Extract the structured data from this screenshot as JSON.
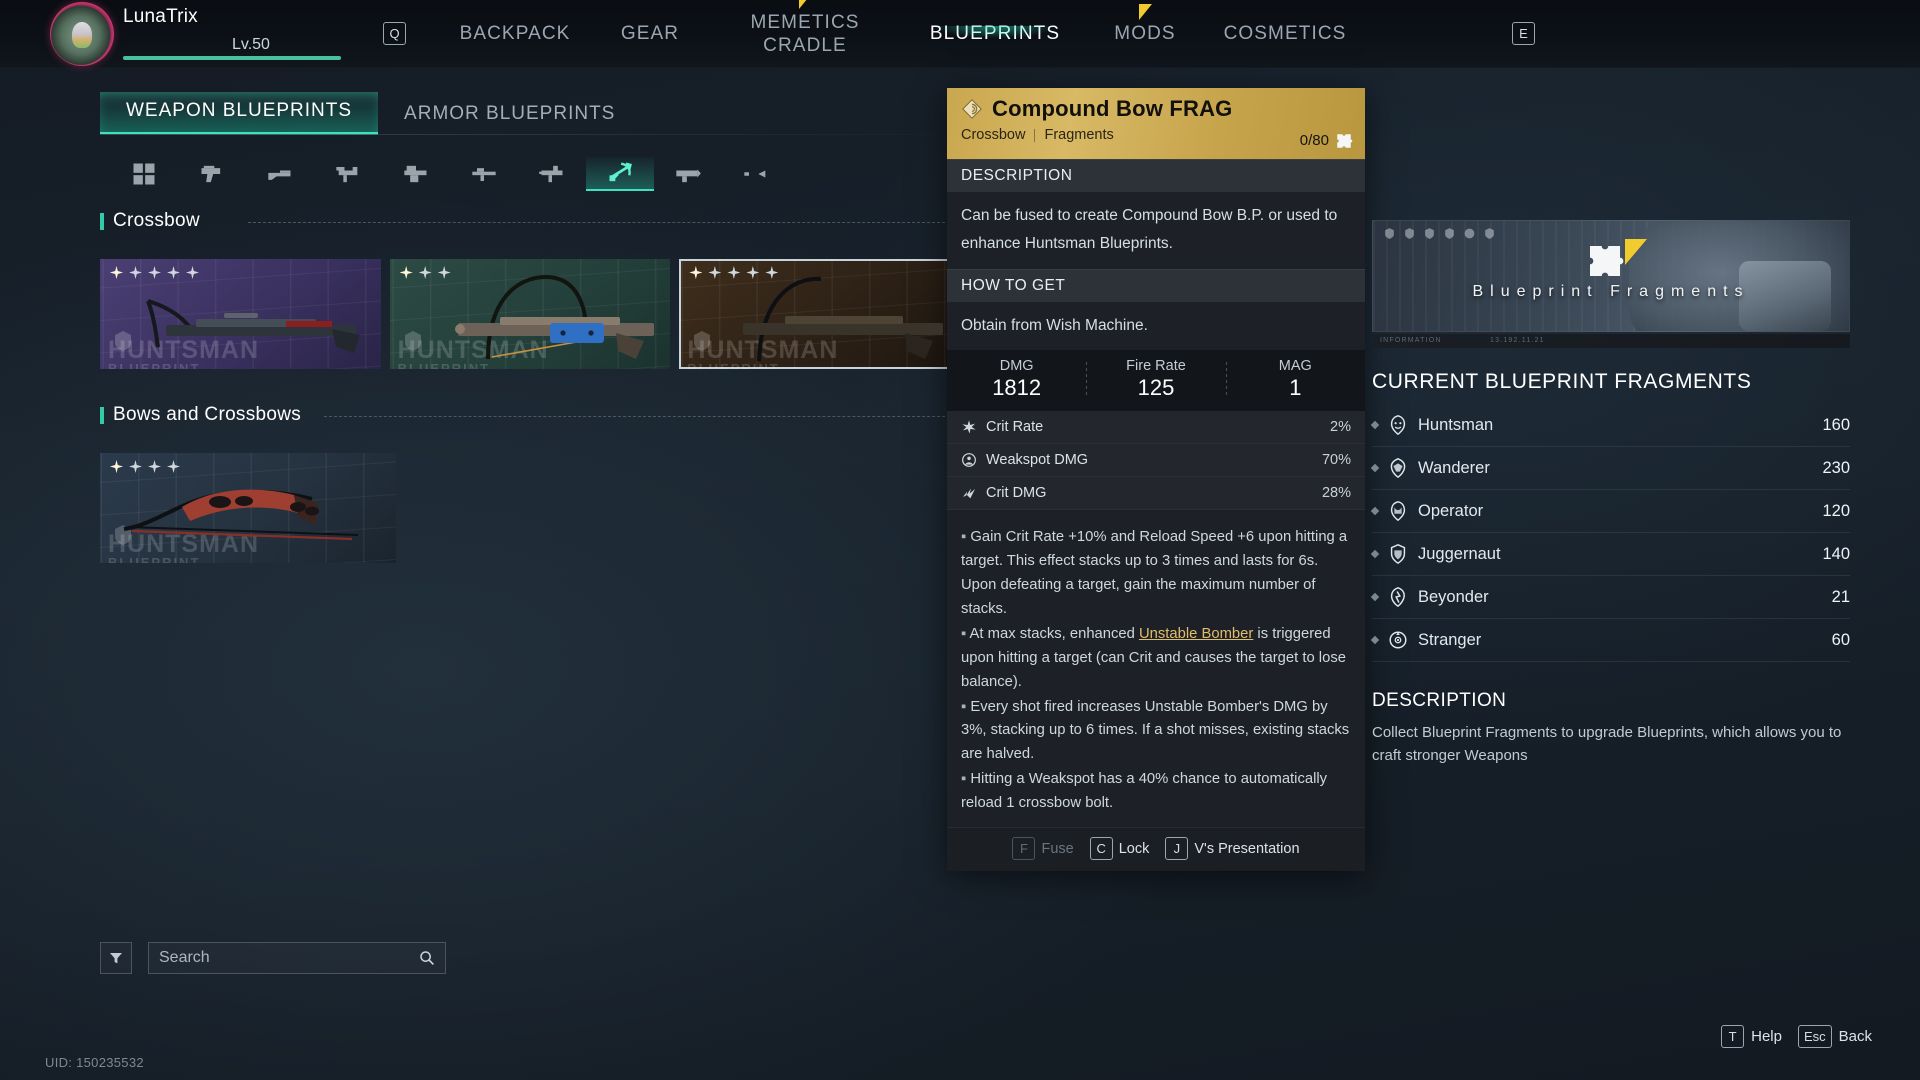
{
  "player": {
    "name": "LunaTrix",
    "level": "Lv.50",
    "key_q": "Q",
    "key_e": "E",
    "uid": "UID: 150235532"
  },
  "nav": {
    "tabs": [
      {
        "label": "BACKPACK",
        "active": false,
        "flag": false
      },
      {
        "label": "GEAR",
        "active": false,
        "flag": false
      },
      {
        "label": "MEMETICS\nCRADLE",
        "line1": "MEMETICS",
        "line2": "CRADLE",
        "active": false,
        "flag": true
      },
      {
        "label": "BLUEPRINTS",
        "active": true,
        "flag": false
      },
      {
        "label": "MODS",
        "active": false,
        "flag": true
      },
      {
        "label": "COSMETICS",
        "active": false,
        "flag": false
      }
    ]
  },
  "subtabs": [
    {
      "label": "WEAPON BLUEPRINTS",
      "active": true
    },
    {
      "label": "ARMOR BLUEPRINTS",
      "active": false
    }
  ],
  "categories": [
    {
      "name": "all-weapons",
      "icon": "grid-icon",
      "active": false
    },
    {
      "name": "pistol",
      "icon": "pistol-icon",
      "active": false
    },
    {
      "name": "shotgun",
      "icon": "shotgun-icon",
      "active": false
    },
    {
      "name": "smg",
      "icon": "smg-icon",
      "active": false
    },
    {
      "name": "lmg",
      "icon": "lmg-icon",
      "active": false
    },
    {
      "name": "rifle",
      "icon": "rifle-icon",
      "active": false
    },
    {
      "name": "assault-rifle",
      "icon": "assault-rifle-icon",
      "active": false
    },
    {
      "name": "crossbow",
      "icon": "crossbow-icon",
      "active": true
    },
    {
      "name": "launcher",
      "icon": "launcher-icon",
      "active": false
    },
    {
      "name": "melee",
      "icon": "melee-icon",
      "active": false
    }
  ],
  "sections": [
    {
      "title": "Crossbow",
      "cards": [
        {
          "stars_total": 5,
          "stars_filled": 1,
          "watermark": "HUNTSMAN",
          "watermark_sub": "BLUEPRINT",
          "selected": false,
          "tone": "c1"
        },
        {
          "stars_total": 3,
          "stars_filled": 1,
          "watermark": "HUNTSMAN",
          "watermark_sub": "BLUEPRINT",
          "selected": false,
          "tone": "c2"
        },
        {
          "stars_total": 5,
          "stars_filled": 1,
          "watermark": "HUNTSMAN",
          "watermark_sub": "BLUEPRINT",
          "selected": true,
          "tone": "c3"
        }
      ]
    },
    {
      "title": "Bows and Crossbows",
      "cards": [
        {
          "stars_total": 4,
          "stars_filled": 1,
          "watermark": "HUNTSMAN",
          "watermark_sub": "BLUEPRINT",
          "selected": false,
          "tone": "c4"
        }
      ]
    }
  ],
  "search": {
    "placeholder": "Search",
    "value": "",
    "icon": "search-icon",
    "filter_icon": "filter-icon"
  },
  "tooltip": {
    "title": "Compound Bow FRAG",
    "type": "Crossbow",
    "subtype": "Fragments",
    "count": "0/80",
    "sections": {
      "description_label": "DESCRIPTION",
      "howto_label": "HOW TO GET"
    },
    "description": "Can be fused to create Compound Bow B.P. or used to enhance Huntsman Blueprints.",
    "how_to_get": "Obtain from Wish Machine.",
    "stats": [
      {
        "label": "DMG",
        "value": "1812"
      },
      {
        "label": "Fire Rate",
        "value": "125"
      },
      {
        "label": "MAG",
        "value": "1"
      }
    ],
    "substats": [
      {
        "icon": "crit-rate-icon",
        "label": "Crit Rate",
        "value": "2%"
      },
      {
        "icon": "weakspot-icon",
        "label": "Weakspot DMG",
        "value": "70%"
      },
      {
        "icon": "crit-dmg-icon",
        "label": "Crit DMG",
        "value": "28%"
      }
    ],
    "perks": [
      {
        "pre": "Gain Crit Rate +10% and Reload Speed +6 upon hitting a target. This effect stacks up to 3 times and lasts for 6s. Upon defeating a target, gain the maximum number of stacks.",
        "hl": "",
        "post": ""
      },
      {
        "pre": "At max stacks, enhanced ",
        "hl": "Unstable Bomber",
        "post": " is triggered upon hitting a target (can Crit and causes the target to lose balance)."
      },
      {
        "pre": "Every shot fired increases Unstable Bomber's DMG by 3%, stacking up to 6 times. If a shot misses, existing stacks are halved.",
        "hl": "",
        "post": ""
      },
      {
        "pre": "Hitting a Weakspot has a 40% chance to automatically reload 1 crossbow bolt.",
        "hl": "",
        "post": ""
      }
    ],
    "footer": [
      {
        "key": "F",
        "label": "Fuse",
        "disabled": true
      },
      {
        "key": "C",
        "label": "Lock",
        "disabled": false
      },
      {
        "key": "J",
        "label": "V's Presentation",
        "disabled": false
      }
    ]
  },
  "right_panel": {
    "banner_title": "Blueprint Fragments",
    "banner_icon": "puzzle-piece-icon",
    "info_strip_left": "INFORMATION",
    "info_strip_right": "13.192.11.21",
    "list_title": "CURRENT BLUEPRINT FRAGMENTS",
    "fragments": [
      {
        "icon": "huntsman-emblem-icon",
        "name": "Huntsman",
        "amount": "160"
      },
      {
        "icon": "wanderer-emblem-icon",
        "name": "Wanderer",
        "amount": "230"
      },
      {
        "icon": "operator-emblem-icon",
        "name": "Operator",
        "amount": "120"
      },
      {
        "icon": "juggernaut-emblem-icon",
        "name": "Juggernaut",
        "amount": "140"
      },
      {
        "icon": "beyonder-emblem-icon",
        "name": "Beyonder",
        "amount": "21"
      },
      {
        "icon": "stranger-emblem-icon",
        "name": "Stranger",
        "amount": "60"
      }
    ],
    "description_label": "DESCRIPTION",
    "description": "Collect Blueprint Fragments to upgrade Blueprints, which allows you to craft stronger Weapons"
  },
  "bottom_keys": [
    {
      "key": "T",
      "label": "Help"
    },
    {
      "key": "Esc",
      "label": "Back"
    }
  ],
  "colors": {
    "accent": "#3fe0bd",
    "gold": "#c9a74f",
    "flag": "#f2cc2e",
    "highlight": "#dfbe6a"
  }
}
